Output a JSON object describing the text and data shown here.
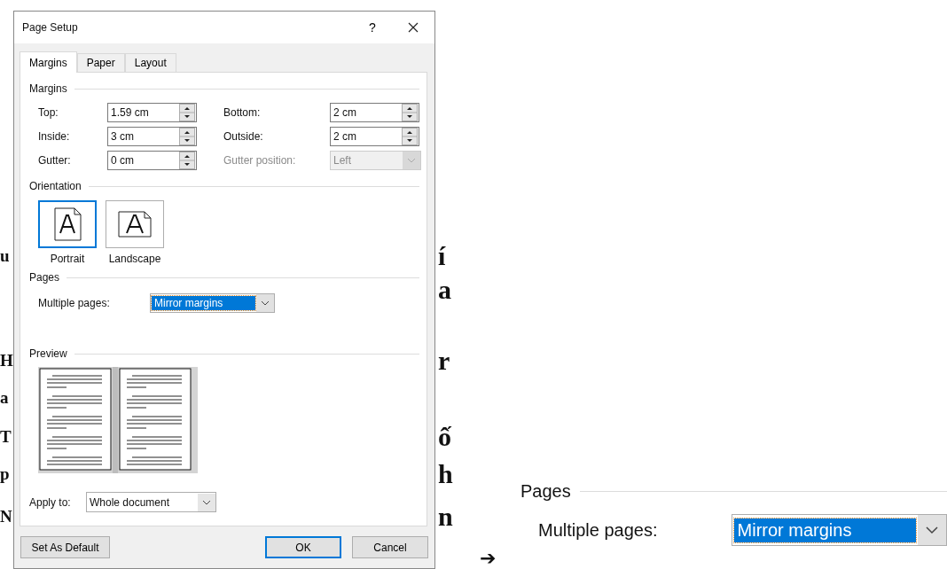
{
  "document": {
    "left_fragments": [
      "u",
      "H",
      "a",
      "T",
      "p",
      "N"
    ],
    "right_fragments": [
      "í",
      "a",
      "r",
      "ố",
      "h",
      "n"
    ]
  },
  "dialog": {
    "title": "Page Setup",
    "help": "?",
    "tabs": [
      {
        "label": "Margins",
        "selected": true
      },
      {
        "label": "Paper",
        "selected": false
      },
      {
        "label": "Layout",
        "selected": false
      }
    ],
    "margins": {
      "heading": "Margins",
      "fields": [
        {
          "label": "Top:",
          "value": "1.59 cm",
          "kind": "spin",
          "disabled": false
        },
        {
          "label": "Bottom:",
          "value": "2 cm",
          "kind": "spin",
          "disabled": false
        },
        {
          "label": "Inside:",
          "value": "3 cm",
          "kind": "spin",
          "disabled": false
        },
        {
          "label": "Outside:",
          "value": "2 cm",
          "kind": "spin",
          "disabled": false
        },
        {
          "label": "Gutter:",
          "value": "0 cm",
          "kind": "spin",
          "disabled": false
        },
        {
          "label": "Gutter position:",
          "value": "Left",
          "kind": "dropdown",
          "disabled": true
        }
      ]
    },
    "orientation": {
      "heading": "Orientation",
      "options": [
        {
          "label": "Portrait",
          "selected": true
        },
        {
          "label": "Landscape",
          "selected": false
        }
      ]
    },
    "pages": {
      "heading": "Pages",
      "label": "Multiple pages:",
      "value": "Mirror margins",
      "highlighted": true
    },
    "preview": {
      "heading": "Preview"
    },
    "apply_to": {
      "label": "Apply to:",
      "value": "Whole document"
    },
    "buttons": [
      {
        "label": "Set As Default",
        "default": false
      },
      {
        "label": "OK",
        "default": true
      },
      {
        "label": "Cancel",
        "default": false
      }
    ]
  },
  "zoom_inset": {
    "heading": "Pages",
    "label": "Multiple pages:",
    "value": "Mirror margins",
    "highlighted": true
  },
  "arrow": "➔"
}
